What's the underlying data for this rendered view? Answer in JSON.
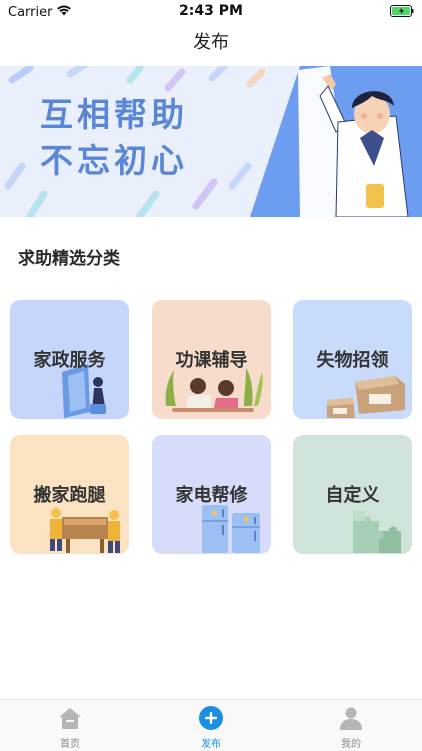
{
  "status_bar": {
    "carrier": "Carrier",
    "time": "2:43 PM"
  },
  "nav": {
    "title": "发布"
  },
  "banner": {
    "line1": "互相帮助",
    "line2": "不忘初心"
  },
  "section": {
    "title": "求助精选分类"
  },
  "categories": [
    {
      "label": "家政服务",
      "bg": "#c6d6fb"
    },
    {
      "label": "功课辅导",
      "bg": "#f7dccb"
    },
    {
      "label": "失物招领",
      "bg": "#c8dbfb"
    },
    {
      "label": "搬家跑腿",
      "bg": "#fbe2c3"
    },
    {
      "label": "家电帮修",
      "bg": "#d8dcfb"
    },
    {
      "label": "自定义",
      "bg": "#cfe3d8"
    }
  ],
  "tabs": [
    {
      "label": "首页",
      "icon": "home-icon"
    },
    {
      "label": "发布",
      "icon": "plus-circle-icon"
    },
    {
      "label": "我的",
      "icon": "user-icon"
    }
  ],
  "colors": {
    "accent": "#1a8fe3",
    "banner_text": "#5a86d8",
    "banner_bg_right": "#6d9df0"
  }
}
